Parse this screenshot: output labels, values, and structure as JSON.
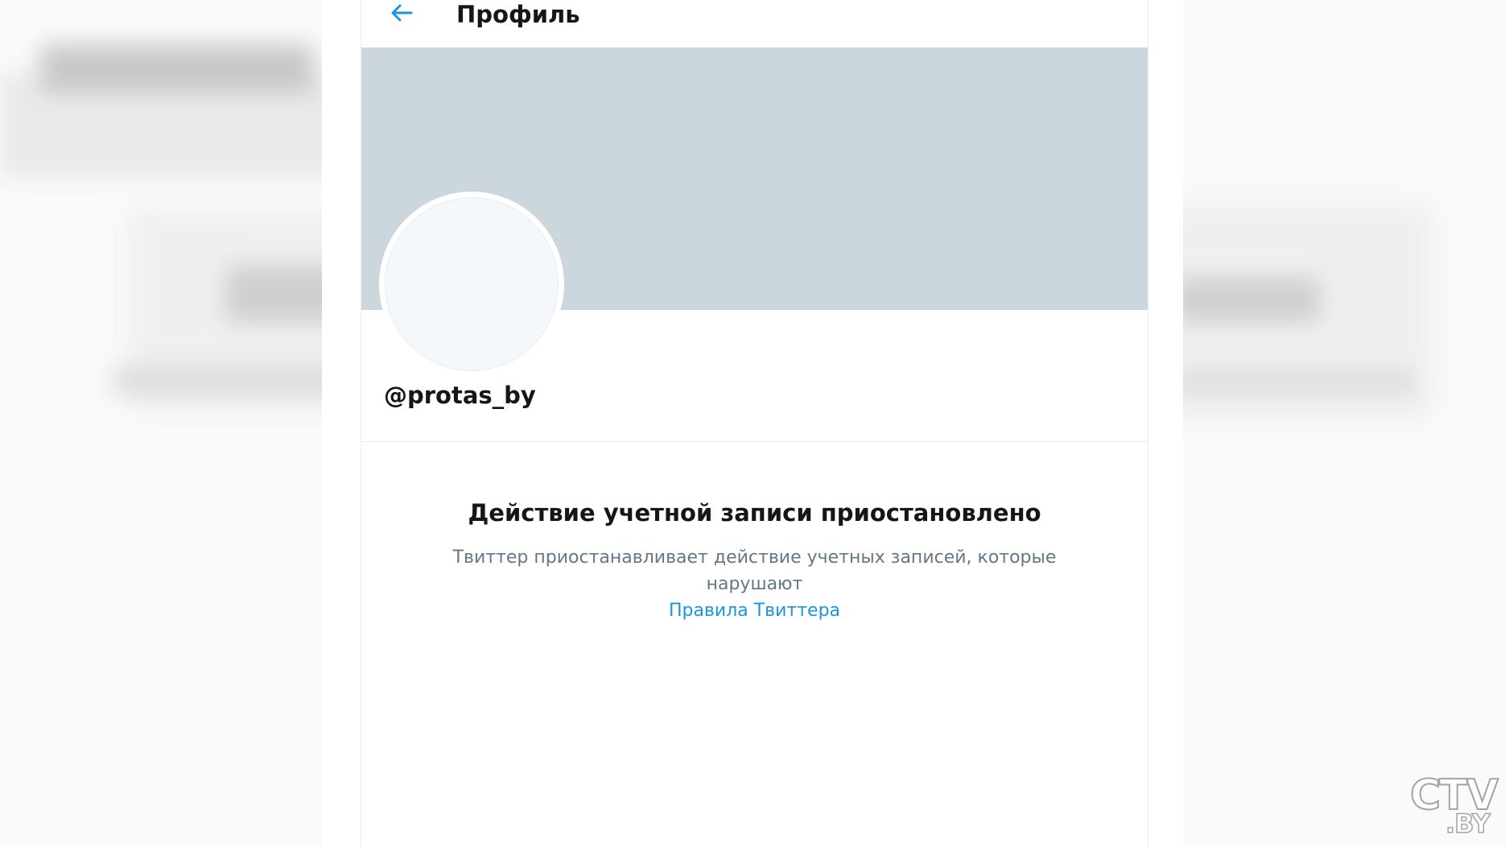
{
  "header": {
    "title": "Профиль",
    "back_icon": "arrow-left-icon"
  },
  "profile": {
    "handle": "@protas_by"
  },
  "notice": {
    "title": "Действие учетной записи приостановлено",
    "text": "Твиттер приостанавливает действие учетных записей, которые нарушают",
    "link_label": "Правила Твиттера"
  },
  "watermark": {
    "line1": "CTV",
    "line2": ".BY"
  },
  "colors": {
    "accent": "#1b95e0",
    "banner": "#ccd6dd",
    "text_primary": "#14171a",
    "text_secondary": "#657786"
  }
}
